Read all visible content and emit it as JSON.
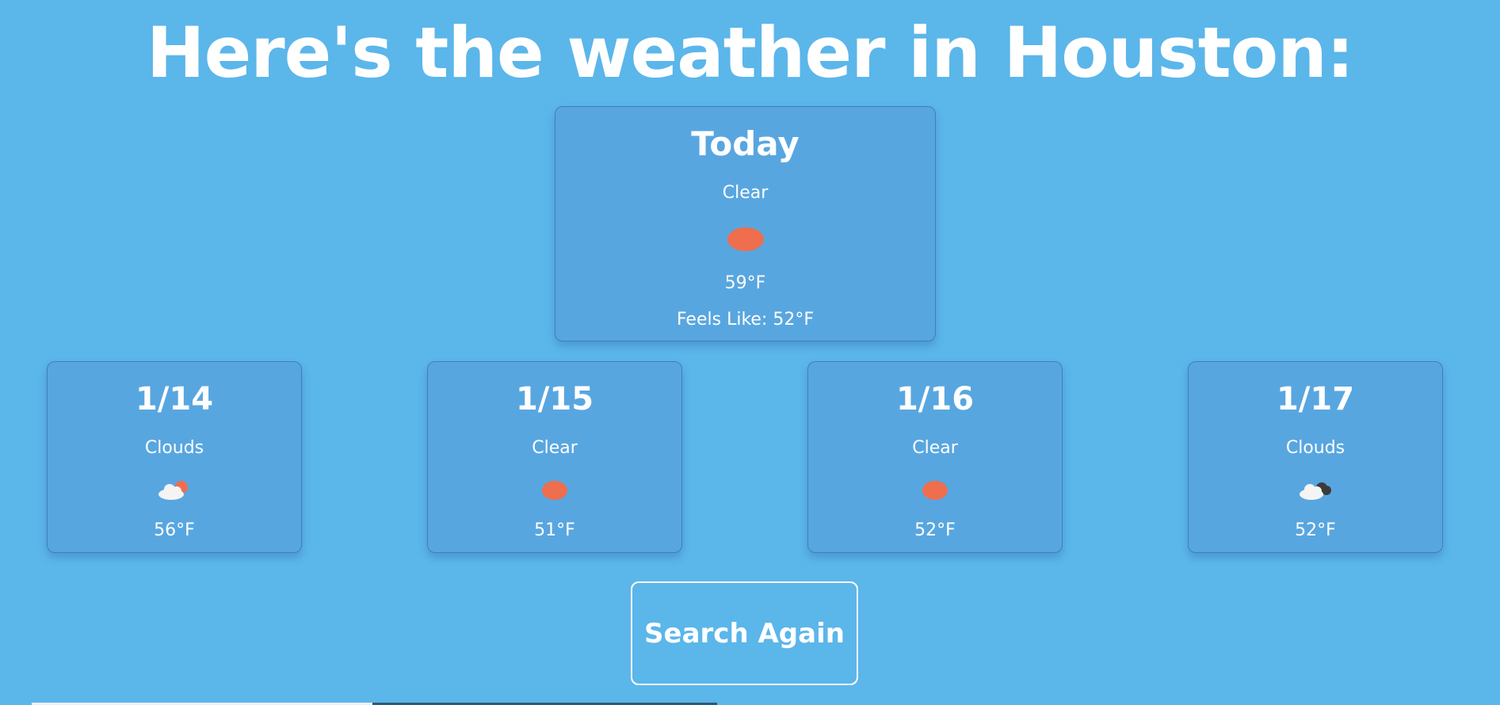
{
  "headline": "Here's the weather in Houston:",
  "today": {
    "title": "Today",
    "condition": "Clear",
    "icon": "sun-icon",
    "temp": "59°F",
    "feels_like": "Feels Like: 52°F"
  },
  "forecast": [
    {
      "date": "1/14",
      "condition": "Clouds",
      "icon": "cloud-sun-icon",
      "temp": "56°F"
    },
    {
      "date": "1/15",
      "condition": "Clear",
      "icon": "sun-icon",
      "temp": "51°F"
    },
    {
      "date": "1/16",
      "condition": "Clear",
      "icon": "sun-icon",
      "temp": "52°F"
    },
    {
      "date": "1/17",
      "condition": "Clouds",
      "icon": "cloud-dark-icon",
      "temp": "52°F"
    }
  ],
  "search_button": "Search Again",
  "colors": {
    "background": "#5bb6ea",
    "card": "#58a6e0",
    "sun": "#ee6e4e",
    "text": "#ffffff"
  }
}
